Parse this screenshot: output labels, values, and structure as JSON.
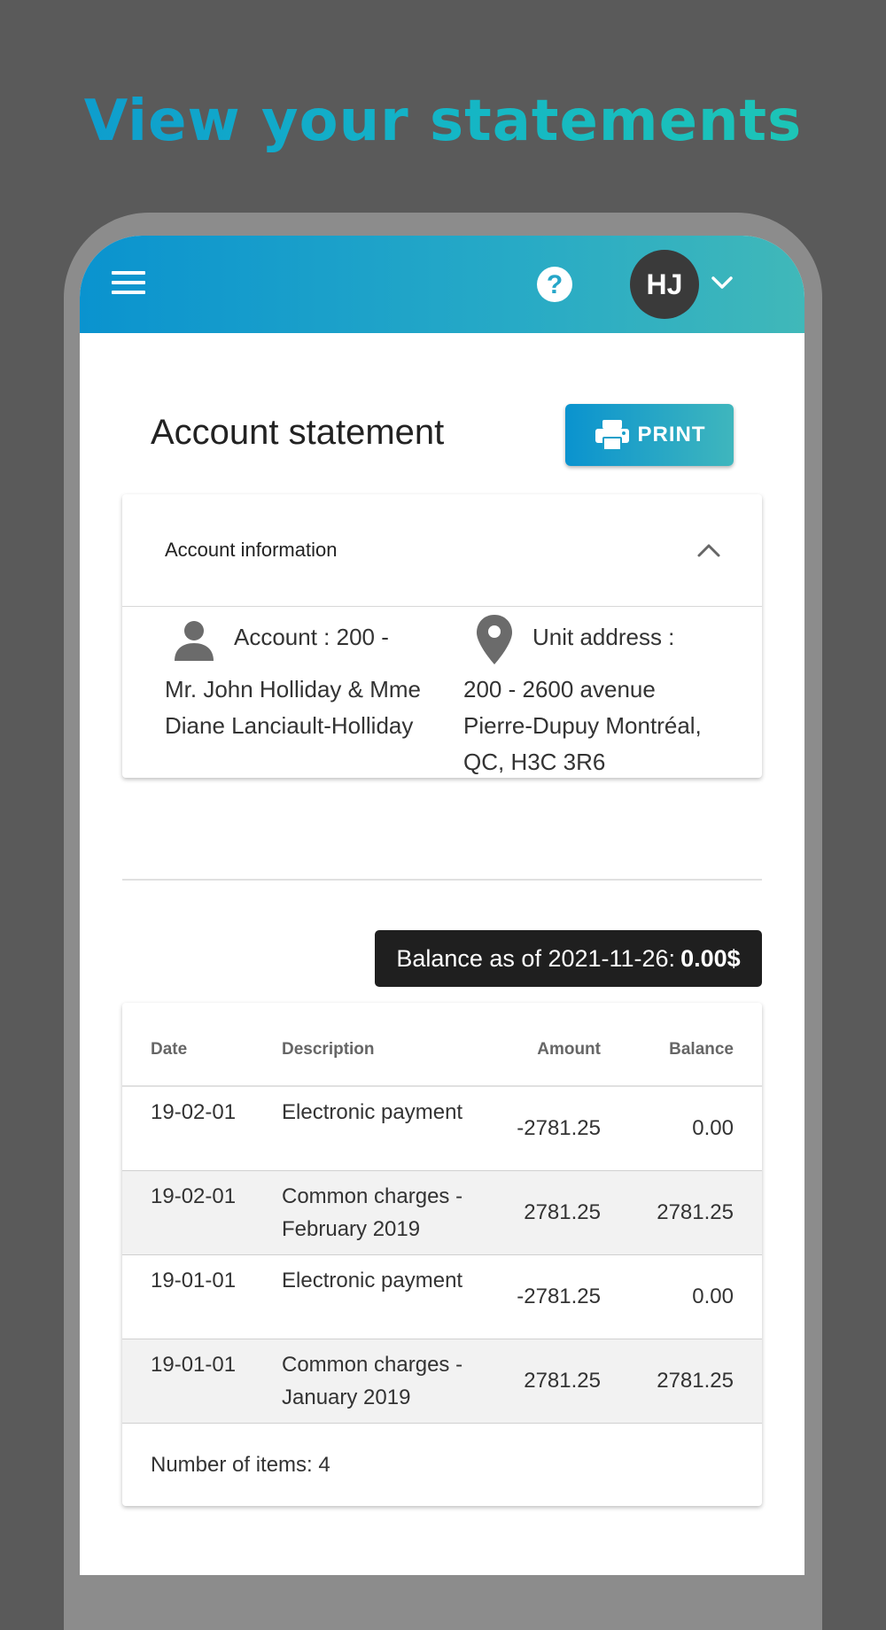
{
  "promo": {
    "title": "View your statements"
  },
  "appbar": {
    "avatar_initials": "HJ",
    "help_symbol": "?"
  },
  "page": {
    "title": "Account statement",
    "print_label": "PRINT"
  },
  "account_info": {
    "header": "Account information",
    "account_label": "Account : 200 -",
    "account_holder": "Mr. John Holliday & Mme Diane Lanciault-Holliday",
    "address_label": "Unit address :",
    "address_value": "200 - 2600 avenue Pierre-Dupuy Montréal, QC, H3C 3R6"
  },
  "balance": {
    "prefix": "Balance as of 2021-11-26:",
    "value": "0.00$"
  },
  "table": {
    "headers": {
      "date": "Date",
      "description": "Description",
      "amount": "Amount",
      "balance": "Balance"
    },
    "rows": [
      {
        "date": "19-02-01",
        "description": "Electronic payment",
        "amount": "-2781.25",
        "balance": "0.00"
      },
      {
        "date": "19-02-01",
        "description": "Common charges - February 2019",
        "amount": "2781.25",
        "balance": "2781.25"
      },
      {
        "date": "19-01-01",
        "description": "Electronic payment",
        "amount": "-2781.25",
        "balance": "0.00"
      },
      {
        "date": "19-01-01",
        "description": "Common charges - January 2019",
        "amount": "2781.25",
        "balance": "2781.25"
      }
    ],
    "footer": "Number of items: 4"
  },
  "colors": {
    "accent_start": "#0a93cf",
    "accent_end": "#40b8b9",
    "balance_bg": "#1f1f1f"
  }
}
